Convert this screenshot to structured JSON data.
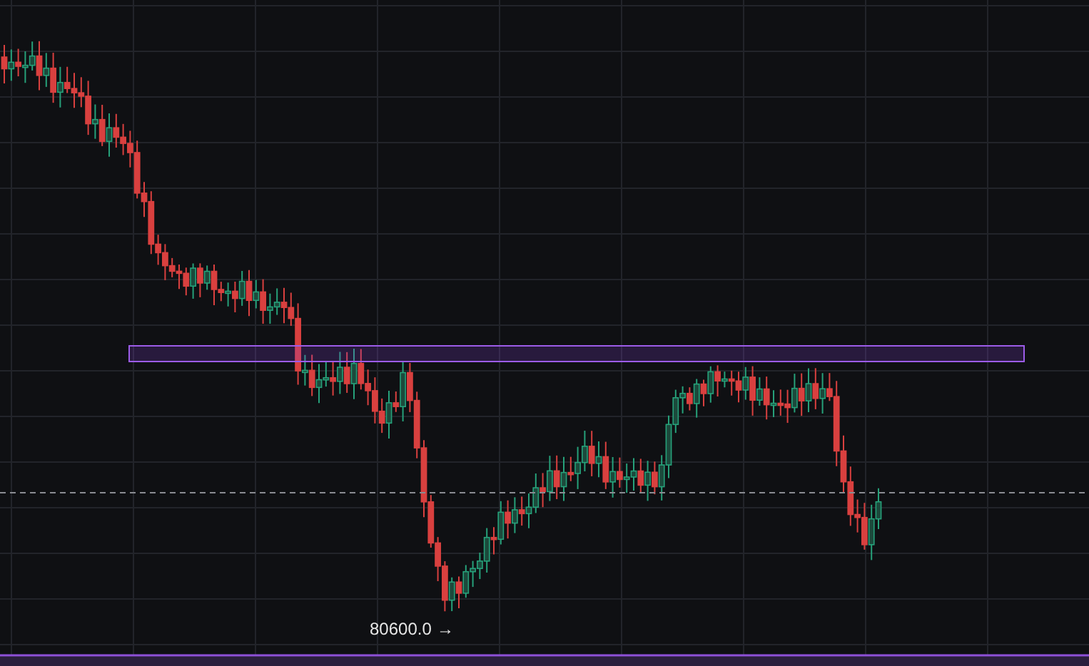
{
  "chart": {
    "low_label": "80600.0",
    "low_arrow": "→"
  }
}
